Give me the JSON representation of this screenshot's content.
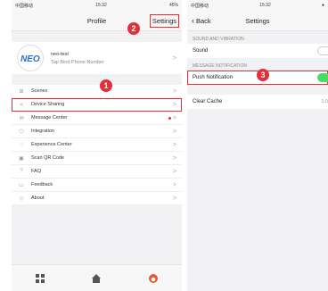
{
  "left_screen": {
    "status": {
      "carrier": "中国移动",
      "time": "15:32",
      "battery": "45%"
    },
    "nav": {
      "title": "Profile",
      "right_button": "Settings"
    },
    "profile": {
      "name": "neo-test",
      "subtitle": "Tap Bind Phone Number"
    },
    "menu_items": [
      {
        "label": "Scenes",
        "icon": "scenes-icon"
      },
      {
        "label": "Device Sharing",
        "icon": "share-icon",
        "highlighted": true
      },
      {
        "label": "Message Center",
        "icon": "message-icon",
        "unread_dot": true
      },
      {
        "label": "Integration",
        "icon": "integration-icon"
      },
      {
        "label": "Experience Center",
        "icon": "heart-icon"
      },
      {
        "label": "Scan QR Code",
        "icon": "qr-icon"
      },
      {
        "label": "FAQ",
        "icon": "question-icon"
      },
      {
        "label": "Feedback",
        "icon": "feedback-icon"
      },
      {
        "label": "About",
        "icon": "diamond-icon"
      }
    ],
    "tabs": [
      "home-icon",
      "smart-icon",
      "me-icon"
    ]
  },
  "right_screen": {
    "status": {
      "carrier": "中国移动",
      "time": "15:32"
    },
    "nav": {
      "back_label": "Back",
      "title": "Settings"
    },
    "sections": {
      "sound": {
        "header": "SOUND AND VIBRATION",
        "row_label": "Sound",
        "enabled": false
      },
      "message": {
        "header": "MESSAGE NOTIFICATION",
        "row_label": "Push Notification",
        "enabled": true
      },
      "cache": {
        "row_label": "Clear Cache",
        "value": "1.0"
      }
    }
  },
  "annotations": {
    "step1": "1",
    "step2": "2",
    "step3": "3"
  },
  "colors": {
    "highlight": "#e2303b",
    "toggle_on": "#4cd964",
    "tab_active": "#e65a2e"
  }
}
